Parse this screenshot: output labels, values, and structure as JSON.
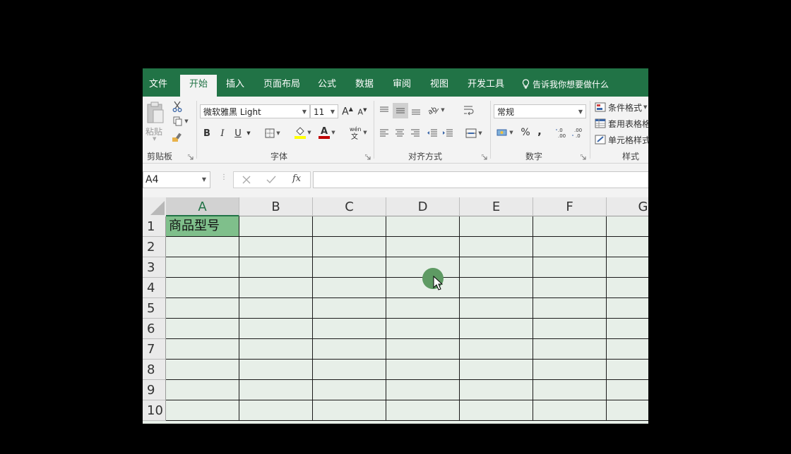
{
  "tabs": [
    {
      "label": "文件",
      "active": false
    },
    {
      "label": "开始",
      "active": true
    },
    {
      "label": "插入",
      "active": false
    },
    {
      "label": "页面布局",
      "active": false
    },
    {
      "label": "公式",
      "active": false
    },
    {
      "label": "数据",
      "active": false
    },
    {
      "label": "审阅",
      "active": false
    },
    {
      "label": "视图",
      "active": false
    },
    {
      "label": "开发工具",
      "active": false
    }
  ],
  "tell_me": "告诉我你想要做什么",
  "ribbon": {
    "clipboard": {
      "paste_label": "粘贴",
      "group_label": "剪贴板"
    },
    "font": {
      "font_name": "微软雅黑 Light",
      "font_size": "11",
      "bold": "B",
      "italic": "I",
      "underline": "U",
      "group_label": "字体",
      "fill_color": "#ffff00",
      "font_color": "#c00000"
    },
    "alignment": {
      "group_label": "对齐方式"
    },
    "number": {
      "format": "常规",
      "percent": "%",
      "comma": ",",
      "group_label": "数字"
    },
    "styles": {
      "conditional": "条件格式",
      "table": "套用表格格",
      "cell": "单元格样式",
      "group_label": "样式"
    }
  },
  "formula_bar": {
    "name_box": "A4",
    "fx": "fx",
    "formula": ""
  },
  "columns": [
    "A",
    "B",
    "C",
    "D",
    "E",
    "F",
    "G"
  ],
  "rows": [
    "1",
    "2",
    "3",
    "4",
    "5",
    "6",
    "7",
    "8",
    "9",
    "10"
  ],
  "cells": {
    "A1": "商品型号"
  },
  "colors": {
    "accent": "#217346",
    "highlight_cell": "#7fbf8b",
    "grid_bg": "#e7efe8"
  }
}
